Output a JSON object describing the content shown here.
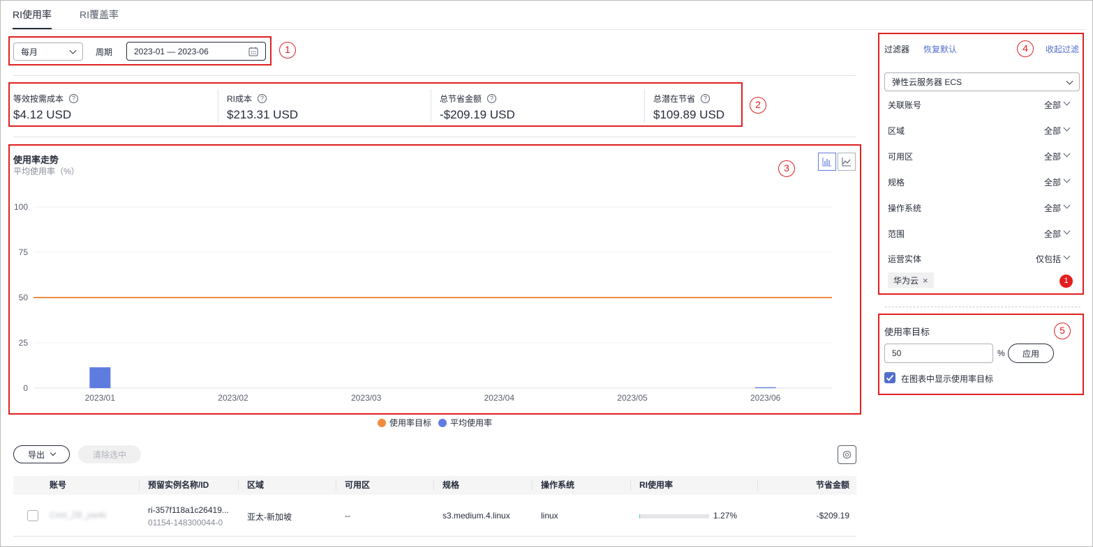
{
  "tabs": [
    {
      "label": "RI使用率",
      "active": true
    },
    {
      "label": "RI覆盖率",
      "active": false
    }
  ],
  "controls": {
    "granularity": "每月",
    "period_label": "周期",
    "period_value": "2023-01 — 2023-06"
  },
  "annotations": [
    "1",
    "2",
    "3",
    "4",
    "5"
  ],
  "stats": [
    {
      "title": "等效按需成本",
      "value": "$4.12 USD"
    },
    {
      "title": "RI成本",
      "value": "$213.31 USD"
    },
    {
      "title": "总节省金额",
      "value": "-$209.19 USD"
    },
    {
      "title": "总潜在节省",
      "value": "$109.89 USD"
    }
  ],
  "help_glyph": "?",
  "chart_data": {
    "type": "bar",
    "title": "使用率走势",
    "ylabel": "平均使用率（%）",
    "categories": [
      "2023/01",
      "2023/02",
      "2023/03",
      "2023/04",
      "2023/05",
      "2023/06"
    ],
    "y_ticks": [
      "100",
      "75",
      "50",
      "25",
      "0"
    ],
    "ylim": [
      0,
      100
    ],
    "grid": true,
    "series": [
      {
        "name": "平均使用率",
        "type": "bar",
        "color": "#5e7ce0",
        "values": [
          11.5,
          0,
          0,
          0,
          0,
          0.5
        ]
      },
      {
        "name": "使用率目标",
        "type": "line",
        "color": "#f08b3d",
        "values": [
          50,
          50,
          50,
          50,
          50,
          50
        ]
      }
    ],
    "legend_position": "bottom-center"
  },
  "toolbar": {
    "export_label": "导出",
    "clear_label": "清除选中"
  },
  "table": {
    "columns": [
      "账号",
      "预留实例名称/ID",
      "区域",
      "可用区",
      "规格",
      "操作系统",
      "RI使用率",
      "节省金额"
    ],
    "rows": [
      {
        "account": "Cost_ZB_yaoki",
        "instance_name": "ri-357f118a1c26419...",
        "instance_id": "01154-148300044-0",
        "region": "亚太-新加坡",
        "az": "--",
        "flavor": "s3.medium.4.linux",
        "os": "linux",
        "utilization": "1.27%",
        "utilization_value": 1.27,
        "savings": "-$209.19"
      }
    ]
  },
  "filter": {
    "title": "过滤器",
    "reset_label": "恢复默认",
    "collapse_label": "收起过滤",
    "service": "弹性云服务器 ECS",
    "items": [
      {
        "label": "关联账号",
        "value": "全部"
      },
      {
        "label": "区域",
        "value": "全部"
      },
      {
        "label": "可用区",
        "value": "全部"
      },
      {
        "label": "规格",
        "value": "全部"
      },
      {
        "label": "操作系统",
        "value": "全部"
      },
      {
        "label": "范围",
        "value": "全部"
      },
      {
        "label": "运营实体",
        "value": "仅包括"
      }
    ],
    "tag": "华为云",
    "tag_count": "1"
  },
  "target": {
    "title": "使用率目标",
    "value": "50",
    "unit": "%",
    "apply_label": "应用",
    "checkbox_label": "在图表中显示使用率目标",
    "checked": true
  }
}
